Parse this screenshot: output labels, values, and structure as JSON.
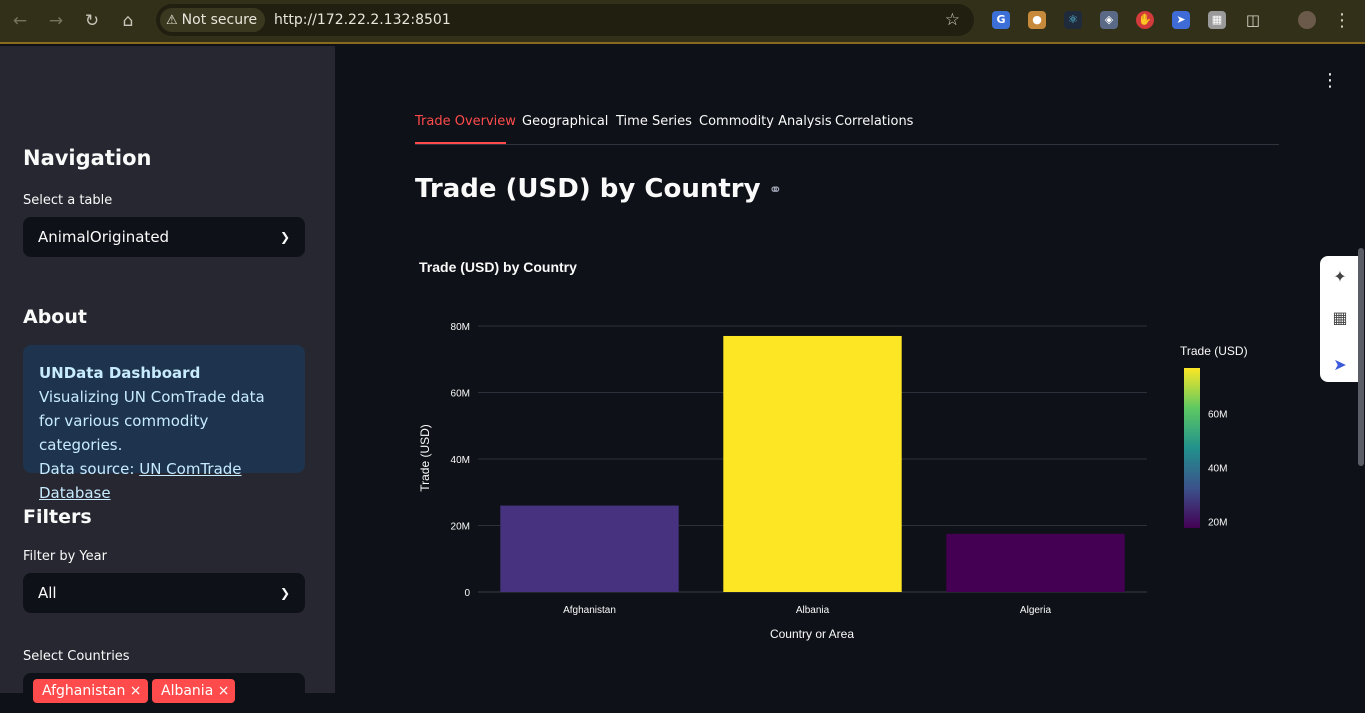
{
  "browser": {
    "security_label": "Not secure",
    "url": "http://172.22.2.132:8501"
  },
  "sidebar": {
    "navigation_heading": "Navigation",
    "select_table_label": "Select a table",
    "select_table_value": "AnimalOriginated",
    "about_heading": "About",
    "about_title": "UNData Dashboard",
    "about_text": "Visualizing UN ComTrade data for various commodity categories.",
    "about_source_prefix": "Data source: ",
    "about_source_link": "UN ComTrade Database",
    "filters_heading": "Filters",
    "filter_year_label": "Filter by Year",
    "filter_year_value": "All",
    "select_countries_label": "Select Countries",
    "selected_countries": [
      "Afghanistan",
      "Albania"
    ]
  },
  "main": {
    "tabs": [
      {
        "label": "Trade Overview",
        "active": true
      },
      {
        "label": "Geographical",
        "active": false
      },
      {
        "label": "Time Series",
        "active": false
      },
      {
        "label": "Commodity Analysis",
        "active": false
      },
      {
        "label": "Correlations",
        "active": false
      }
    ],
    "page_title": "Trade (USD) by Country"
  },
  "chart_data": {
    "type": "bar",
    "title": "Trade (USD) by Country",
    "xlabel": "Country or Area",
    "ylabel": "Trade (USD)",
    "categories": [
      "Afghanistan",
      "Albania",
      "Algeria"
    ],
    "values": [
      26000000,
      77000000,
      17500000
    ],
    "ylim": [
      0,
      80000000
    ],
    "y_ticks": [
      "0",
      "20M",
      "40M",
      "60M",
      "80M"
    ],
    "colorscale": "viridis",
    "bar_colors": [
      "#46327e",
      "#fde725",
      "#440154"
    ],
    "colorbar_title": "Trade (USD)",
    "colorbar_ticks": [
      "20M",
      "40M",
      "60M"
    ],
    "grid": true
  }
}
